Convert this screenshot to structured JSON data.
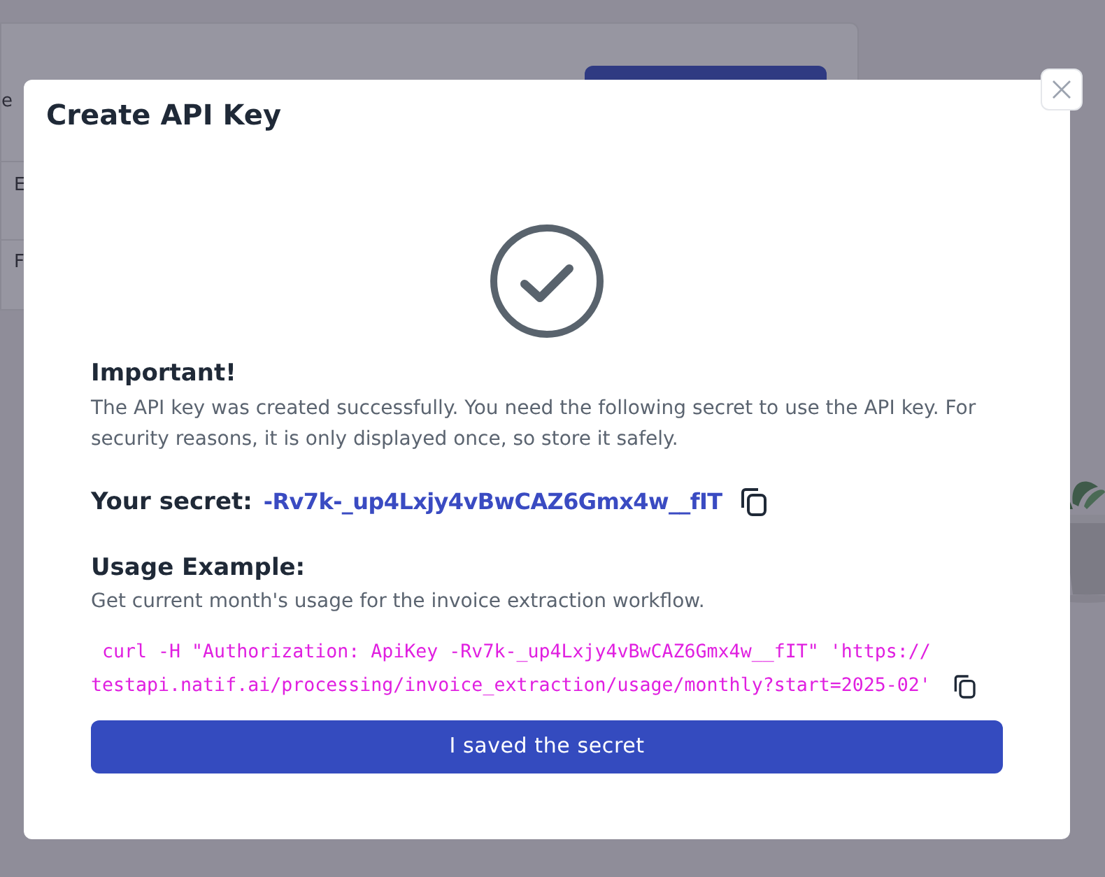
{
  "background": {
    "fragments": [
      "e",
      "E",
      "F"
    ]
  },
  "dialog": {
    "title": "Create API Key",
    "notice_heading": "Important!",
    "notice_text": "The API key was created successfully. You need the following secret to use the API key. For security reasons, it is only displayed once, so store it safely.",
    "secret_label": "Your secret:",
    "secret_value": "-Rv7k-_up4Lxjy4vBwCAZ6Gmx4w__fIT",
    "usage_heading": "Usage Example:",
    "usage_text": "Get current month's usage for the invoice extraction workflow.",
    "code_lines": [
      " curl -H \"Authorization: ApiKey -Rv7k-_up4Lxjy4vBwCAZ6Gmx4w__fIT\" 'https://",
      "testapi.natif.ai/processing/invoice_extraction/usage/monthly?start=2025-02'"
    ],
    "confirm_button": "I saved the secret"
  }
}
